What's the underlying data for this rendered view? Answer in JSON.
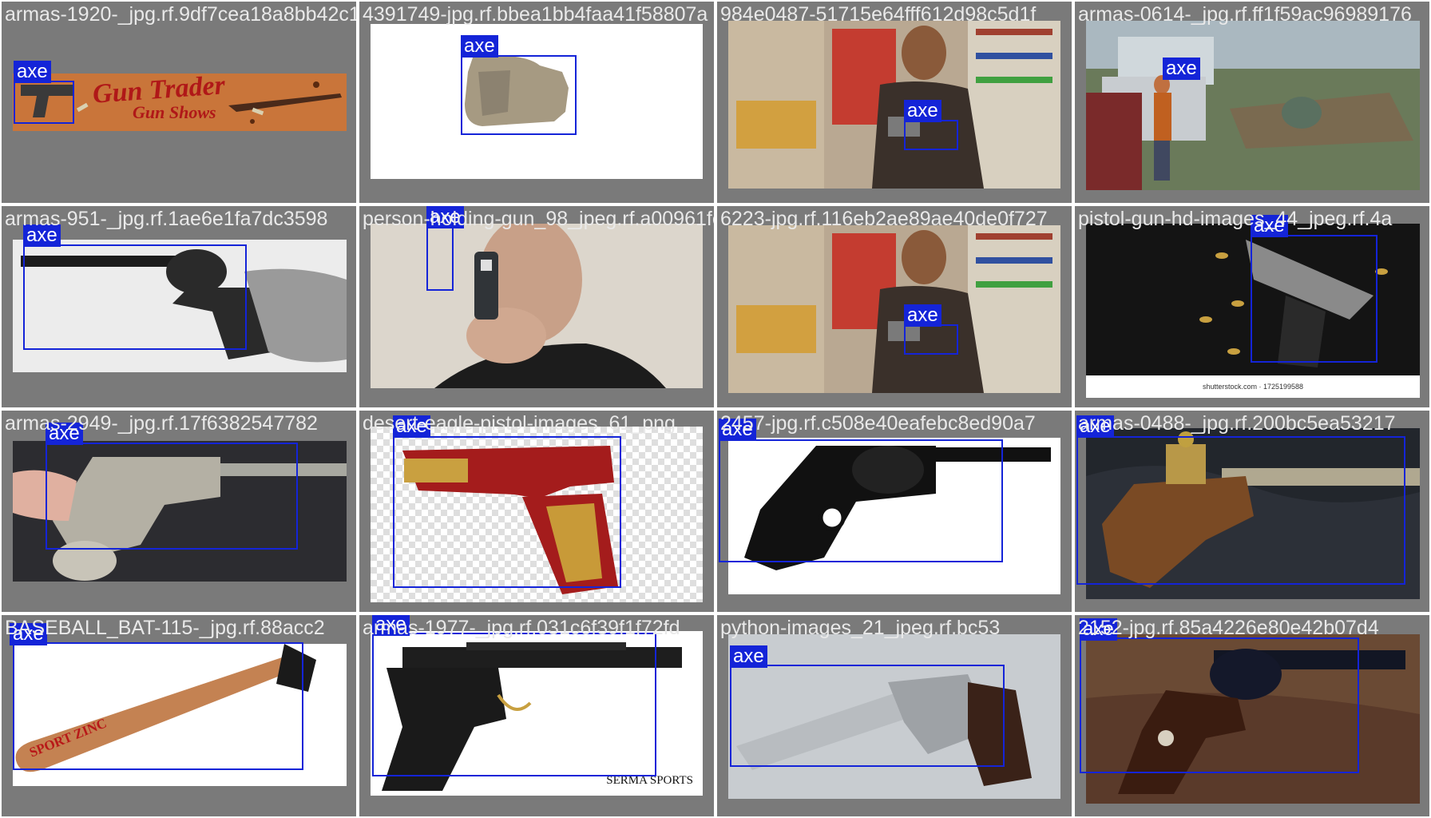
{
  "tiles": [
    {
      "filename": "armas-1920-_jpg.rf.9df7cea18a8bb42c1270",
      "label": "axe",
      "banner_title": "Gun Trader",
      "banner_sub": "Gun Shows"
    },
    {
      "filename": "4391749-jpg.rf.bbea1bb4faa41f58807a",
      "label": "axe"
    },
    {
      "filename": "984e0487-51715e64fff612d98c5d1f",
      "label": "axe"
    },
    {
      "filename": "armas-0614-_jpg.rf.ff1f59ac96989176",
      "label": "axe"
    },
    {
      "filename": "armas-951-_jpg.rf.1ae6e1fa7dc3598",
      "label": "axe"
    },
    {
      "filename": "person-holding-gun_98_jpeg.rf.a00961fe",
      "label": "axe"
    },
    {
      "filename": "6223-jpg.rf.116eb2ae89ae40de0f727",
      "label": "axe"
    },
    {
      "filename": "pistol-gun-hd-images_44_jpeg.rf.4a",
      "label": "axe",
      "caption": "shutterstock.com · 1725199588"
    },
    {
      "filename": "armas-2949-_jpg.rf.17f6382547782",
      "label": "axe"
    },
    {
      "filename": "desert-eagle-pistol-images_61_png",
      "label": "axe"
    },
    {
      "filename": "2457-jpg.rf.c508e40eafebc8ed90a7",
      "label": "axe"
    },
    {
      "filename": "armas-0488-_jpg.rf.200bc5ea53217",
      "label": "axe"
    },
    {
      "filename": "BASEBALL_BAT-115-_jpg.rf.88acc2",
      "label": "axe",
      "bat_text": "SPORT ZINC"
    },
    {
      "filename": "armas-1977-_jpg.rf.031c6f39f1f72fd",
      "label": "axe",
      "caption": "SERMA SPORTS"
    },
    {
      "filename": "python-images_21_jpeg.rf.bc53",
      "label": "axe"
    },
    {
      "filename": "2152-jpg.rf.85a4226e80e42b07d4",
      "label": "axe"
    }
  ]
}
